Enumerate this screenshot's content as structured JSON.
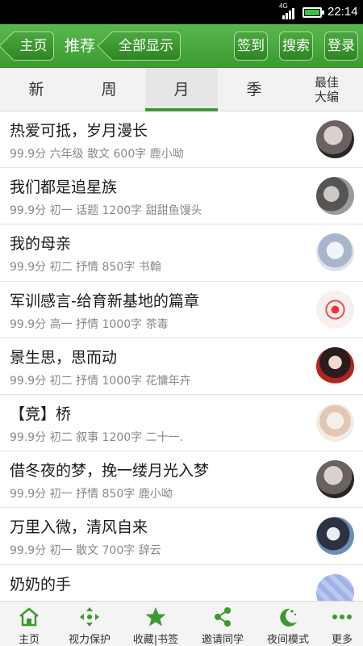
{
  "status": {
    "network": "4G",
    "time": "22:14"
  },
  "header": {
    "home_label": "主页",
    "title": "推荐",
    "show_all_label": "全部显示",
    "checkin_label": "签到",
    "search_label": "搜索",
    "login_label": "登录"
  },
  "tabs": [
    {
      "label": "新"
    },
    {
      "label": "周"
    },
    {
      "label": "月"
    },
    {
      "label": "季"
    },
    {
      "label": "最佳大编"
    }
  ],
  "active_tab": "月",
  "articles": [
    {
      "title": "热爱可抵，岁月漫长",
      "meta": "99.9分 六年级 散文 600字 鹿小呦",
      "avatar": "portrait-dark"
    },
    {
      "title": "我们都是追星族",
      "meta": "99.9分 初一 话题 1200字 甜甜鱼馒头",
      "avatar": "portrait-gray"
    },
    {
      "title": "我的母亲",
      "meta": "99.9分 初二 抒情 850字 书翰",
      "avatar": "anime-blue"
    },
    {
      "title": "军训感言-给育新基地的篇章",
      "meta": "99.9分 高一 抒情 1000字 茶毒",
      "avatar": "red-flower"
    },
    {
      "title": "景生思，思而动",
      "meta": "99.9分 初二 抒情 1000字 花慵年卉",
      "avatar": "girl-red"
    },
    {
      "title": "【竞】桥",
      "meta": "99.9分 初二 叙事 1200字 二十一.",
      "avatar": "anime-white"
    },
    {
      "title": "借冬夜的梦，挽一缕月光入梦",
      "meta": "99.9分 初一 抒情 850字 鹿小呦",
      "avatar": "portrait-dark"
    },
    {
      "title": "万里入微，清风自来",
      "meta": "99.9分 初一 散文 700字 辞云",
      "avatar": "anime-dark"
    },
    {
      "title": "奶奶的手",
      "meta": "",
      "avatar": "blue-pattern"
    }
  ],
  "bottom_nav": [
    {
      "label": "主页",
      "icon": "home-icon"
    },
    {
      "label": "视力保护",
      "icon": "eye-protect-icon"
    },
    {
      "label": "收藏|书签",
      "icon": "star-icon"
    },
    {
      "label": "邀请同学",
      "icon": "share-icon"
    },
    {
      "label": "夜间模式",
      "icon": "moon-icon"
    },
    {
      "label": "更多",
      "icon": "more-icon"
    }
  ],
  "colors": {
    "accent_green": "#3c9a31",
    "header_green": "#58b84e"
  }
}
